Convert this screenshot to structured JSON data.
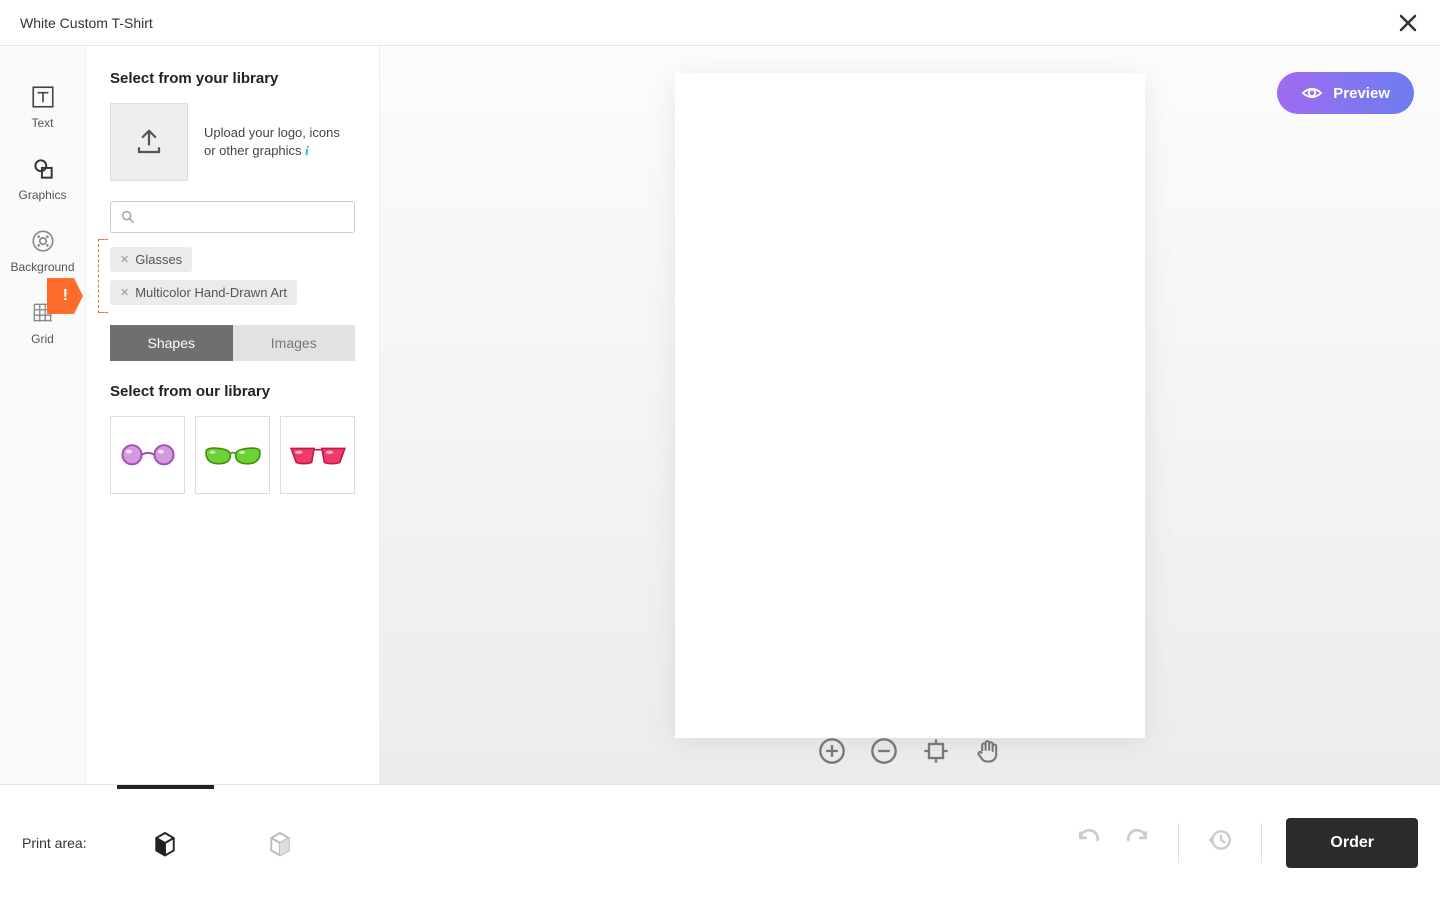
{
  "header": {
    "title": "White Custom T-Shirt"
  },
  "rail": {
    "text": "Text",
    "graphics": "Graphics",
    "background": "Background",
    "grid": "Grid",
    "alert": "!"
  },
  "panel": {
    "your_library_title": "Select from your library",
    "upload_text": "Upload your logo, icons or other graphics ",
    "info_glyph": "i",
    "search_placeholder": "",
    "tags": {
      "0": "Glasses",
      "1": "Multicolor Hand-Drawn Art"
    },
    "seg": {
      "shapes": "Shapes",
      "images": "Images"
    },
    "our_library_title": "Select from our library"
  },
  "canvas": {
    "preview": "Preview"
  },
  "footer": {
    "print_area": "Print area:",
    "order": "Order"
  }
}
